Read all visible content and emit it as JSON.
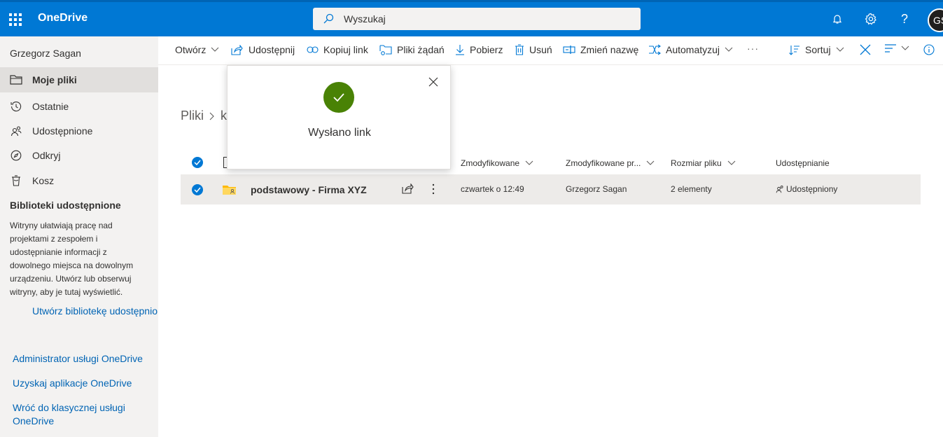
{
  "app": {
    "name": "OneDrive"
  },
  "search": {
    "placeholder": "Wyszukaj"
  },
  "user": {
    "initials": "GS",
    "name": "Grzegorz Sagan"
  },
  "sidebar": {
    "items": [
      {
        "label": "Moje pliki",
        "icon": "folder-icon",
        "active": true
      },
      {
        "label": "Ostatnie",
        "icon": "history-icon"
      },
      {
        "label": "Udostępnione",
        "icon": "people-icon"
      },
      {
        "label": "Odkryj",
        "icon": "compass-icon"
      },
      {
        "label": "Kosz",
        "icon": "trash-icon"
      }
    ],
    "shared_libraries_title": "Biblioteki udostępnione",
    "shared_libraries_desc": "Witryny ułatwiają pracę nad projektami z zespołem i udostępnianie informacji z dowolnego miejsca na dowolnym urządzeniu. Utwórz lub obserwuj witryny, aby je tutaj wyświetlić.",
    "create_library": "Utwórz bibliotekę udostępnio",
    "footer_links": [
      "Administrator usługi OneDrive",
      "Uzyskaj aplikacje OneDrive",
      "Wróć do klasycznej usługi OneDrive"
    ]
  },
  "commands": {
    "open": "Otwórz",
    "share": "Udostępnij",
    "copy_link": "Kopiuj link",
    "file_requests": "Pliki żądań",
    "download": "Pobierz",
    "delete": "Usuń",
    "rename": "Zmień nazwę",
    "automate": "Automatyzuj",
    "more": "···",
    "sort": "Sortuj"
  },
  "breadcrumb": {
    "root": "Pliki",
    "partial": "k"
  },
  "columns": {
    "modified": "Zmodyfikowane",
    "modified_by": "Zmodyfikowane pr...",
    "size": "Rozmiar pliku",
    "sharing": "Udostępnianie"
  },
  "files": [
    {
      "name": "podstawowy - Firma XYZ",
      "modified": "czwartek o 12:49",
      "modified_by": "Grzegorz Sagan",
      "size": "2 elementy",
      "sharing": "Udostępniony"
    }
  ],
  "toast": {
    "message": "Wysłano link"
  },
  "colors": {
    "brand": "#0078d4",
    "success": "#498205",
    "link": "#0064b4",
    "sidebar_bg": "#f3f2f1"
  }
}
